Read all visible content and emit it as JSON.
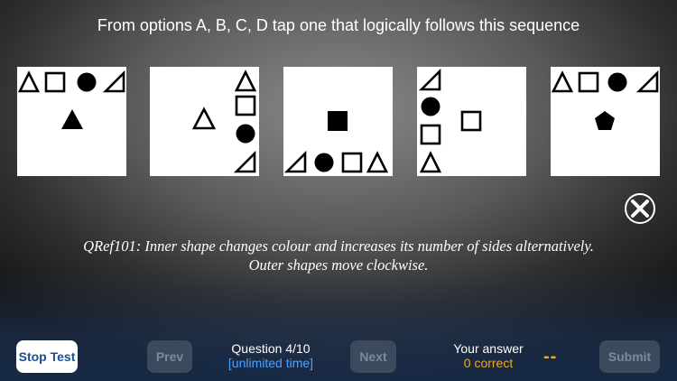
{
  "instruction": "From options A, B, C, D tap one that logically follows this sequence",
  "panels": [
    {
      "name": "sequence-panel-1"
    },
    {
      "name": "sequence-panel-2"
    },
    {
      "name": "sequence-panel-3"
    },
    {
      "name": "sequence-panel-4"
    },
    {
      "name": "sequence-panel-5"
    }
  ],
  "explanation": "QRef101: Inner shape changes colour and increases its number of sides alternatively. Outer shapes move clockwise.",
  "footer": {
    "stop_label": "Stop Test",
    "prev_label": "Prev",
    "question_label": "Question 4/10",
    "time_label": "[unlimited time]",
    "next_label": "Next",
    "your_answer_label": "Your answer",
    "correct_label": "0 correct",
    "answer_value": "--",
    "submit_label": "Submit"
  },
  "colors": {
    "accent_blue": "#4aa3ff",
    "accent_orange": "#f5a623",
    "stop_text": "#1a4f8f"
  },
  "icons": {
    "close": "close-circle-x-icon"
  }
}
